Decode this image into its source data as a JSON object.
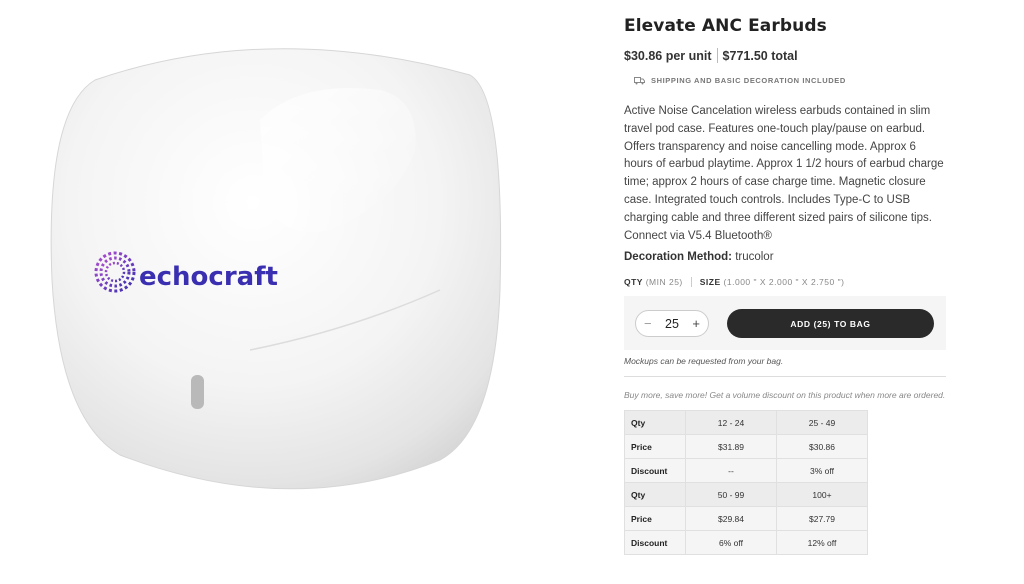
{
  "product": {
    "title": "Elevate ANC Earbuds",
    "unit_price": "$30.86 per unit",
    "total_price": "$771.50 total",
    "shipping_note": "SHIPPING AND BASIC DECORATION INCLUDED",
    "description": "Active Noise Cancelation wireless earbuds contained in slim travel pod case. Features one-touch play/pause on earbud. Offers transparency and noise cancelling mode. Approx 6 hours of earbud playtime. Approx 1 1/2 hours of earbud charge time; approx 2 hours of case charge time. Magnetic closure case. Integrated touch controls. Includes Type-C to USB charging cable and three different sized pairs of silicone tips. Connect via V5.4 Bluetooth®",
    "decoration_label": "Decoration Method:",
    "decoration_value": "trucolor",
    "image_logo_text": "echocraft"
  },
  "specs": {
    "qty_label": "QTY",
    "qty_min": "(MIN 25)",
    "size_label": "SIZE",
    "size_value": "(1.000 \" X 2.000 \" X 2.750 \")"
  },
  "purchase": {
    "decrement": "−",
    "quantity": "25",
    "increment": "+",
    "add_label": "ADD (25) TO BAG",
    "mockup_note": "Mockups can be requested from your bag."
  },
  "volume": {
    "note": "Buy more, save more! Get a volume discount on this product when more are ordered.",
    "labels": {
      "qty": "Qty",
      "price": "Price",
      "discount": "Discount"
    },
    "tiers": [
      {
        "range": "12 - 24",
        "price": "$31.89",
        "discount": "--"
      },
      {
        "range": "25 - 49",
        "price": "$30.86",
        "discount": "3% off"
      },
      {
        "range": "50 - 99",
        "price": "$29.84",
        "discount": "6% off"
      },
      {
        "range": "100+",
        "price": "$27.79",
        "discount": "12% off"
      }
    ]
  },
  "colors": {
    "logo_purple": "#7b3fc4",
    "logo_blue": "#3a2fb0",
    "button_dark": "#2a2a2a"
  }
}
